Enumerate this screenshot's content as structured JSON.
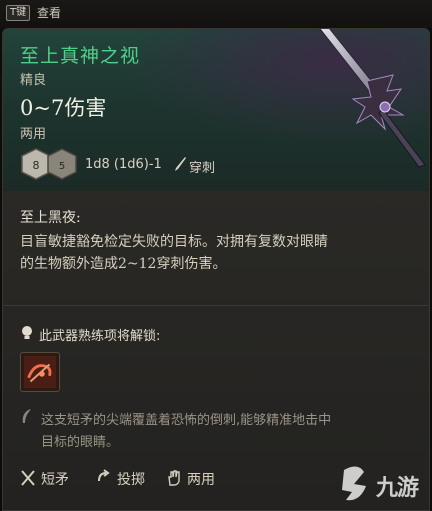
{
  "topbar": {
    "key": "T键",
    "action": "查看"
  },
  "item": {
    "name": "至上真神之视",
    "rarity": "精良",
    "damage": "0~7伤害",
    "handedness": "两用",
    "dice_left": "8",
    "dice_right": "5",
    "dice_roll": "1d8 (1d6)-1",
    "damage_type": "穿刺"
  },
  "passive": {
    "name": "至上黑夜:",
    "lines": [
      "目盲敏捷豁免检定失败的目标。对拥有复数对眼睛",
      "的生物额外造成2~12穿刺伤害。"
    ]
  },
  "unlock": {
    "title": "此武器熟练项将解锁:"
  },
  "flavor": {
    "lines": [
      "这支短矛的尖端覆盖着恐怖的倒刺,能够精准地击中",
      "目标的眼睛。"
    ]
  },
  "properties": [
    {
      "icon": "crossed-spears-icon",
      "label": "短矛"
    },
    {
      "icon": "throw-icon",
      "label": "投掷"
    },
    {
      "icon": "hand-icon",
      "label": "两用"
    }
  ],
  "watermark": {
    "text": "九游"
  },
  "colors": {
    "title": "#4fd08a",
    "header_bg": "#22443b",
    "body_bg": "#2a2926"
  }
}
